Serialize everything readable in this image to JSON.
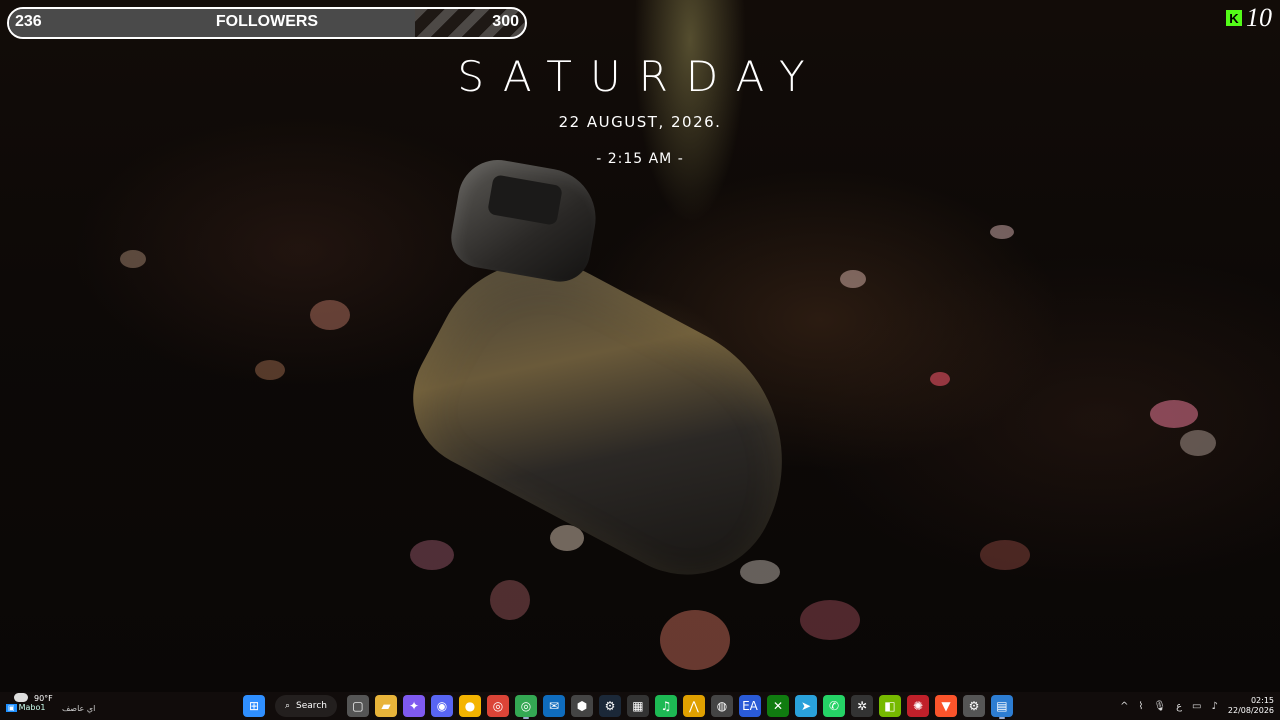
{
  "followers": {
    "current": "236",
    "label": "FOLLOWERS",
    "goal": "300",
    "progress": 0.787
  },
  "kick": {
    "count": "10",
    "logo_letter": "K",
    "color": "#53fc18"
  },
  "clock_widget": {
    "day": "SATURDAY",
    "date": "22 AUGUST, 2026.",
    "time": "- 2:15 AM -"
  },
  "taskbar": {
    "weather": {
      "temp": "90°F",
      "desc": "اي عاصف",
      "channel": "Mabo1"
    },
    "search_label": "Search",
    "apps": [
      {
        "name": "start-icon",
        "glyph": "⊞",
        "color": "#2f8fff"
      },
      {
        "name": "search"
      },
      {
        "name": "task-view-icon",
        "glyph": "▢",
        "color": "#555"
      },
      {
        "name": "file-explorer-icon",
        "glyph": "▰",
        "color": "#e8b43a"
      },
      {
        "name": "copilot-icon",
        "glyph": "✦",
        "color": "#7f5af0"
      },
      {
        "name": "discord-icon",
        "glyph": "◉",
        "color": "#5865f2"
      },
      {
        "name": "chat-icon",
        "glyph": "●",
        "color": "#f4b400"
      },
      {
        "name": "chrome-icon",
        "glyph": "◎",
        "color": "#db4437"
      },
      {
        "name": "chrome-alt-icon",
        "glyph": "◎",
        "color": "#34a853"
      },
      {
        "name": "outlook-icon",
        "glyph": "✉",
        "color": "#0f6cbd"
      },
      {
        "name": "app-cube-icon",
        "glyph": "⬢",
        "color": "#444"
      },
      {
        "name": "steam-icon",
        "glyph": "⚙",
        "color": "#1b2838"
      },
      {
        "name": "qr-icon",
        "glyph": "▦",
        "color": "#333"
      },
      {
        "name": "spotify-icon",
        "glyph": "♫",
        "color": "#1db954"
      },
      {
        "name": "archero-icon",
        "glyph": "⋀",
        "color": "#e0a000"
      },
      {
        "name": "obs-icon",
        "glyph": "◍",
        "color": "#444"
      },
      {
        "name": "ea-icon",
        "glyph": "EA",
        "color": "#2a5bd7"
      },
      {
        "name": "xbox-icon",
        "glyph": "✕",
        "color": "#107c10"
      },
      {
        "name": "telegram-icon",
        "glyph": "➤",
        "color": "#2aa1da"
      },
      {
        "name": "whatsapp-icon",
        "glyph": "✆",
        "color": "#25d366"
      },
      {
        "name": "settings-wheel-icon",
        "glyph": "✲",
        "color": "#333"
      },
      {
        "name": "nvidia-icon",
        "glyph": "◧",
        "color": "#76b900"
      },
      {
        "name": "app-red-icon",
        "glyph": "✺",
        "color": "#c0202a"
      },
      {
        "name": "brave-icon",
        "glyph": "▼",
        "color": "#fb542b"
      },
      {
        "name": "gear-icon",
        "glyph": "⚙",
        "color": "#555"
      },
      {
        "name": "app-blue-icon",
        "glyph": "▤",
        "color": "#2d7dd2"
      }
    ],
    "tray": {
      "up_arrow": "^",
      "lang": "ع",
      "time": "02:15",
      "date": "22/08/2026"
    }
  }
}
